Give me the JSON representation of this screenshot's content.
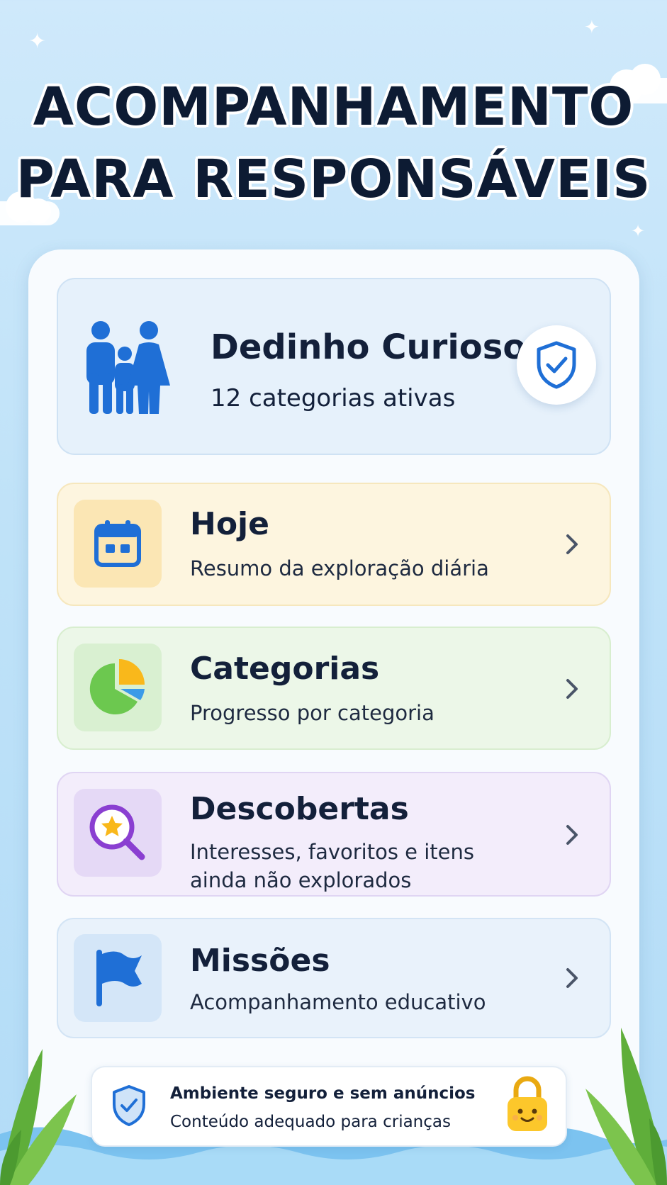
{
  "header": {
    "title_line1": "ACOMPANHAMENTO",
    "title_line2": "PARA RESPONSÁVEIS"
  },
  "profile": {
    "name": "Dedinho Curioso",
    "subtitle": "12 categorias ativas",
    "icon": "family-icon",
    "badge_icon": "shield-check-icon"
  },
  "menu": [
    {
      "title": "Hoje",
      "subtitle": "Resumo da exploração diária",
      "icon": "calendar-icon",
      "bg": "#fdf5df",
      "border": "#f6e7bd",
      "icon_bg": "#fbe6b4"
    },
    {
      "title": "Categorias",
      "subtitle": "Progresso por categoria",
      "icon": "pie-chart-icon",
      "bg": "#ecf7e8",
      "border": "#d8eecf",
      "icon_bg": "#d9f0d1"
    },
    {
      "title": "Descobertas",
      "subtitle_line1": "Interesses, favoritos e itens",
      "subtitle_line2": "ainda não explorados",
      "icon": "search-star-icon",
      "bg": "#f3edfb",
      "border": "#e0d5f3",
      "icon_bg": "#e5d9f6"
    },
    {
      "title": "Missões",
      "subtitle": "Acompanhamento educativo",
      "icon": "flag-icon",
      "bg": "#e9f2fb",
      "border": "#d3e4f5",
      "icon_bg": "#d4e6f8"
    }
  ],
  "footer": {
    "title": "Ambiente seguro e sem anúncios",
    "subtitle": "Conteúdo adequado para crianças",
    "left_icon": "shield-check-icon",
    "right_icon": "lock-icon"
  },
  "colors": {
    "primary_blue": "#1f6fd6",
    "title_text": "#0d1b33"
  }
}
